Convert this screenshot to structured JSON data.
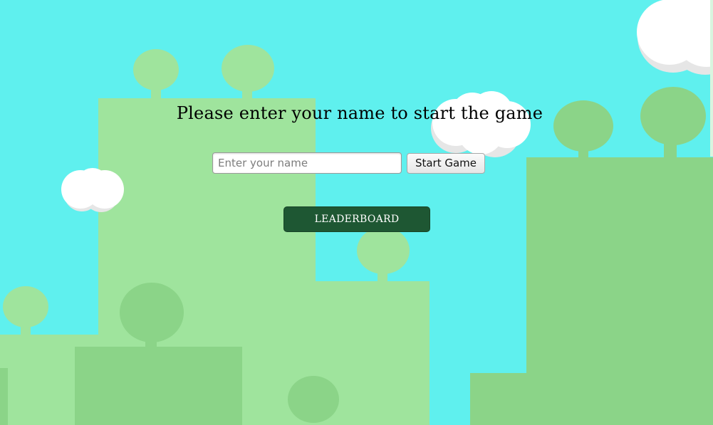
{
  "game": {
    "prompt_text": "Please enter your name to start the game",
    "name_input": {
      "placeholder": "Enter your name",
      "value": ""
    },
    "start_button_label": "Start Game",
    "leaderboard_button_label": "LEADERBOARD"
  },
  "colors": {
    "sky": "#5ff0ee",
    "hill_light": "#9fe49d",
    "hill_mid": "#8bd488",
    "leaderboard_bg": "#1e5733",
    "cloud": "#ffffff"
  }
}
